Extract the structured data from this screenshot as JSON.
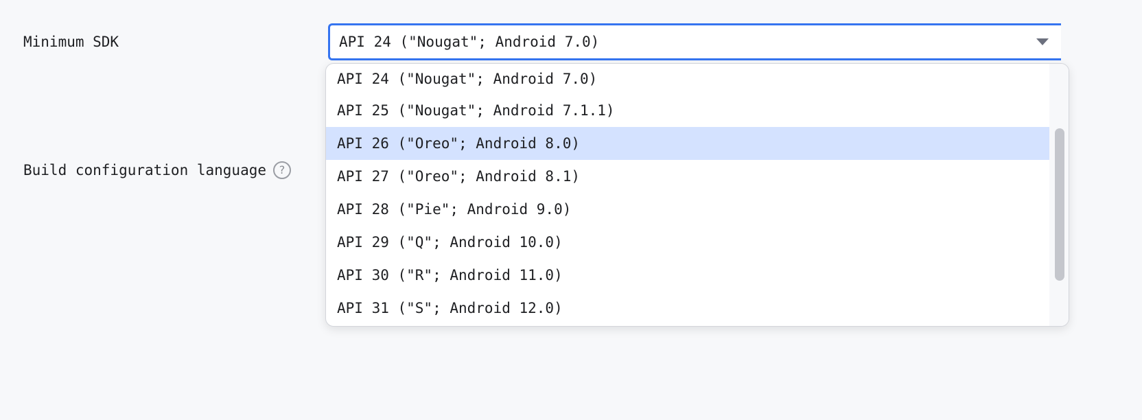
{
  "form": {
    "min_sdk_label": "Minimum SDK",
    "build_lang_label": "Build configuration language",
    "help_glyph": "?"
  },
  "combo": {
    "value": "API 24 (\"Nougat\"; Android 7.0)"
  },
  "dropdown": {
    "options": [
      "API 24 (\"Nougat\"; Android 7.0)",
      "API 25 (\"Nougat\"; Android 7.1.1)",
      "API 26 (\"Oreo\"; Android 8.0)",
      "API 27 (\"Oreo\"; Android 8.1)",
      "API 28 (\"Pie\"; Android 9.0)",
      "API 29 (\"Q\"; Android 10.0)",
      "API 30 (\"R\"; Android 11.0)",
      "API 31 (\"S\"; Android 12.0)"
    ],
    "highlighted_option": "API 26 (\"Oreo\"; Android 8.0)"
  },
  "colors": {
    "accent": "#3574f0",
    "highlight": "#d4e2ff",
    "background": "#f7f8fa"
  },
  "icons": {
    "dropdown_arrow": "chevron-down-icon",
    "help": "help-icon"
  }
}
